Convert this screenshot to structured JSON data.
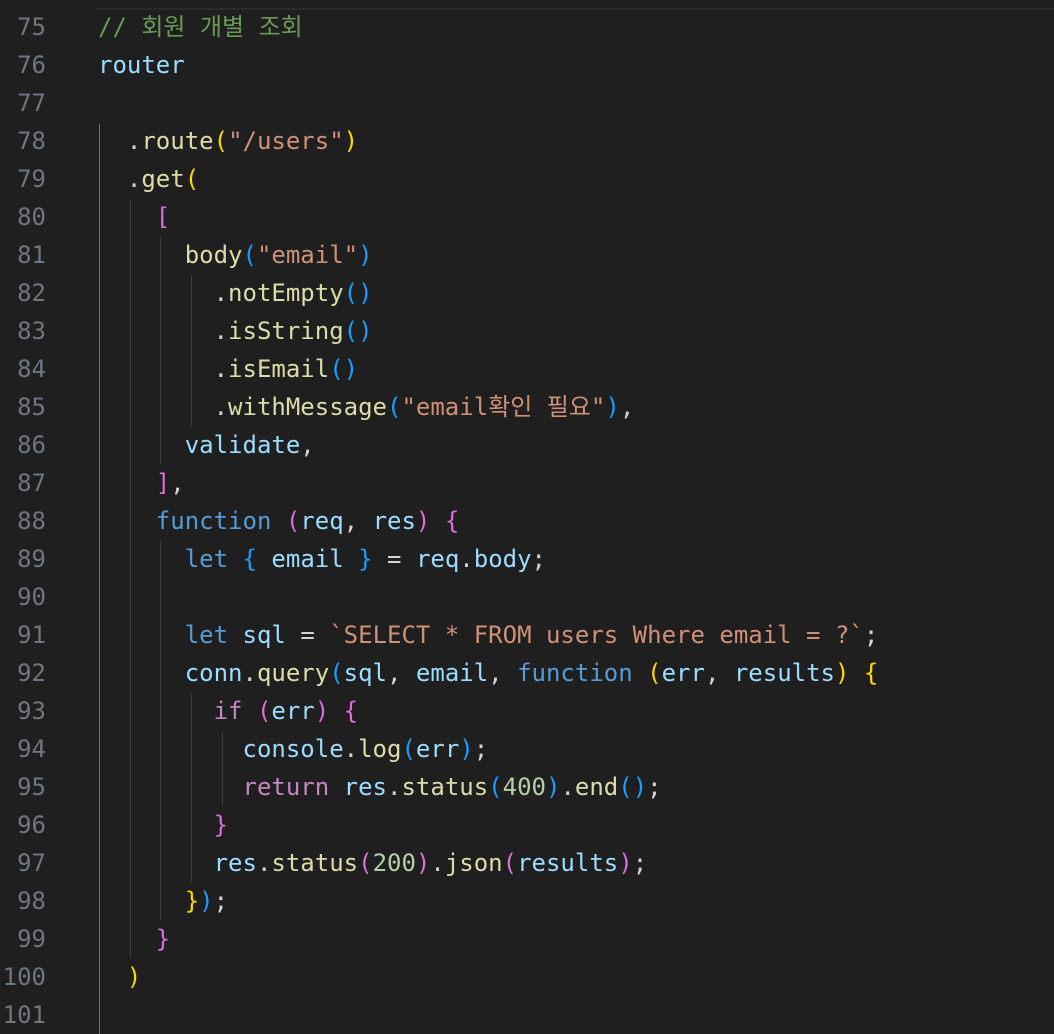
{
  "editor": {
    "colors": {
      "background": "#1f1f1f",
      "line_number": "#6e7681",
      "comment": "#6a9955",
      "variable": "#9cdcfe",
      "function": "#dcdcaa",
      "string": "#ce9178",
      "keyword": "#569cd6",
      "control": "#c586c0",
      "number": "#b5cea8",
      "bracket_level1": "#ffd700",
      "bracket_level2": "#da70d6",
      "bracket_level3": "#179fff"
    },
    "lines": [
      {
        "n": "75",
        "indent": 0,
        "tokens": [
          {
            "t": "// 회원 개별 조회",
            "c": "comment"
          }
        ]
      },
      {
        "n": "76",
        "indent": 0,
        "tokens": [
          {
            "t": "router",
            "c": "var"
          }
        ]
      },
      {
        "n": "77",
        "indent": 0,
        "tokens": []
      },
      {
        "n": "78",
        "indent": 2,
        "tokens": [
          {
            "t": ".",
            "c": "plain"
          },
          {
            "t": "route",
            "c": "fn"
          },
          {
            "t": "(",
            "c": "b1"
          },
          {
            "t": "\"/users\"",
            "c": "str"
          },
          {
            "t": ")",
            "c": "b1"
          }
        ]
      },
      {
        "n": "79",
        "indent": 2,
        "tokens": [
          {
            "t": ".",
            "c": "plain"
          },
          {
            "t": "get",
            "c": "fn"
          },
          {
            "t": "(",
            "c": "b1"
          }
        ]
      },
      {
        "n": "80",
        "indent": 4,
        "tokens": [
          {
            "t": "[",
            "c": "b2"
          }
        ]
      },
      {
        "n": "81",
        "indent": 6,
        "tokens": [
          {
            "t": "body",
            "c": "fn"
          },
          {
            "t": "(",
            "c": "b3"
          },
          {
            "t": "\"email\"",
            "c": "str"
          },
          {
            "t": ")",
            "c": "b3"
          }
        ]
      },
      {
        "n": "82",
        "indent": 8,
        "tokens": [
          {
            "t": ".",
            "c": "plain"
          },
          {
            "t": "notEmpty",
            "c": "fn"
          },
          {
            "t": "()",
            "c": "b3"
          }
        ]
      },
      {
        "n": "83",
        "indent": 8,
        "tokens": [
          {
            "t": ".",
            "c": "plain"
          },
          {
            "t": "isString",
            "c": "fn"
          },
          {
            "t": "()",
            "c": "b3"
          }
        ]
      },
      {
        "n": "84",
        "indent": 8,
        "tokens": [
          {
            "t": ".",
            "c": "plain"
          },
          {
            "t": "isEmail",
            "c": "fn"
          },
          {
            "t": "()",
            "c": "b3"
          }
        ]
      },
      {
        "n": "85",
        "indent": 8,
        "tokens": [
          {
            "t": ".",
            "c": "plain"
          },
          {
            "t": "withMessage",
            "c": "fn"
          },
          {
            "t": "(",
            "c": "b3"
          },
          {
            "t": "\"email확인 필요\"",
            "c": "str"
          },
          {
            "t": ")",
            "c": "b3"
          },
          {
            "t": ",",
            "c": "plain"
          }
        ]
      },
      {
        "n": "86",
        "indent": 6,
        "tokens": [
          {
            "t": "validate",
            "c": "var"
          },
          {
            "t": ",",
            "c": "plain"
          }
        ]
      },
      {
        "n": "87",
        "indent": 4,
        "tokens": [
          {
            "t": "]",
            "c": "b2"
          },
          {
            "t": ",",
            "c": "plain"
          }
        ]
      },
      {
        "n": "88",
        "indent": 4,
        "tokens": [
          {
            "t": "function",
            "c": "kw"
          },
          {
            "t": " ",
            "c": "plain"
          },
          {
            "t": "(",
            "c": "b2"
          },
          {
            "t": "req",
            "c": "var"
          },
          {
            "t": ", ",
            "c": "plain"
          },
          {
            "t": "res",
            "c": "var"
          },
          {
            "t": ")",
            "c": "b2"
          },
          {
            "t": " ",
            "c": "plain"
          },
          {
            "t": "{",
            "c": "b2"
          }
        ]
      },
      {
        "n": "89",
        "indent": 6,
        "tokens": [
          {
            "t": "let",
            "c": "kw"
          },
          {
            "t": " ",
            "c": "plain"
          },
          {
            "t": "{",
            "c": "b3"
          },
          {
            "t": " ",
            "c": "plain"
          },
          {
            "t": "email",
            "c": "var"
          },
          {
            "t": " ",
            "c": "plain"
          },
          {
            "t": "}",
            "c": "b3"
          },
          {
            "t": " = ",
            "c": "plain"
          },
          {
            "t": "req",
            "c": "var"
          },
          {
            "t": ".",
            "c": "plain"
          },
          {
            "t": "body",
            "c": "var"
          },
          {
            "t": ";",
            "c": "plain"
          }
        ]
      },
      {
        "n": "90",
        "indent": 0,
        "tokens": []
      },
      {
        "n": "91",
        "indent": 6,
        "tokens": [
          {
            "t": "let",
            "c": "kw"
          },
          {
            "t": " ",
            "c": "plain"
          },
          {
            "t": "sql",
            "c": "var"
          },
          {
            "t": " = ",
            "c": "plain"
          },
          {
            "t": "`SELECT * FROM users Where email = ?`",
            "c": "str"
          },
          {
            "t": ";",
            "c": "plain"
          }
        ]
      },
      {
        "n": "92",
        "indent": 6,
        "tokens": [
          {
            "t": "conn",
            "c": "var"
          },
          {
            "t": ".",
            "c": "plain"
          },
          {
            "t": "query",
            "c": "fn"
          },
          {
            "t": "(",
            "c": "b3"
          },
          {
            "t": "sql",
            "c": "var"
          },
          {
            "t": ", ",
            "c": "plain"
          },
          {
            "t": "email",
            "c": "var"
          },
          {
            "t": ", ",
            "c": "plain"
          },
          {
            "t": "function",
            "c": "kw"
          },
          {
            "t": " ",
            "c": "plain"
          },
          {
            "t": "(",
            "c": "b1"
          },
          {
            "t": "err",
            "c": "var"
          },
          {
            "t": ", ",
            "c": "plain"
          },
          {
            "t": "results",
            "c": "var"
          },
          {
            "t": ")",
            "c": "b1"
          },
          {
            "t": " ",
            "c": "plain"
          },
          {
            "t": "{",
            "c": "b1"
          }
        ]
      },
      {
        "n": "93",
        "indent": 8,
        "tokens": [
          {
            "t": "if",
            "c": "ctrl"
          },
          {
            "t": " ",
            "c": "plain"
          },
          {
            "t": "(",
            "c": "b2"
          },
          {
            "t": "err",
            "c": "var"
          },
          {
            "t": ")",
            "c": "b2"
          },
          {
            "t": " ",
            "c": "plain"
          },
          {
            "t": "{",
            "c": "b2"
          }
        ]
      },
      {
        "n": "94",
        "indent": 10,
        "tokens": [
          {
            "t": "console",
            "c": "var"
          },
          {
            "t": ".",
            "c": "plain"
          },
          {
            "t": "log",
            "c": "fn"
          },
          {
            "t": "(",
            "c": "b3"
          },
          {
            "t": "err",
            "c": "var"
          },
          {
            "t": ")",
            "c": "b3"
          },
          {
            "t": ";",
            "c": "plain"
          }
        ]
      },
      {
        "n": "95",
        "indent": 10,
        "tokens": [
          {
            "t": "return",
            "c": "ctrl"
          },
          {
            "t": " ",
            "c": "plain"
          },
          {
            "t": "res",
            "c": "var"
          },
          {
            "t": ".",
            "c": "plain"
          },
          {
            "t": "status",
            "c": "fn"
          },
          {
            "t": "(",
            "c": "b3"
          },
          {
            "t": "400",
            "c": "num"
          },
          {
            "t": ")",
            "c": "b3"
          },
          {
            "t": ".",
            "c": "plain"
          },
          {
            "t": "end",
            "c": "fn"
          },
          {
            "t": "()",
            "c": "b3"
          },
          {
            "t": ";",
            "c": "plain"
          }
        ]
      },
      {
        "n": "96",
        "indent": 8,
        "tokens": [
          {
            "t": "}",
            "c": "b2"
          }
        ]
      },
      {
        "n": "97",
        "indent": 8,
        "tokens": [
          {
            "t": "res",
            "c": "var"
          },
          {
            "t": ".",
            "c": "plain"
          },
          {
            "t": "status",
            "c": "fn"
          },
          {
            "t": "(",
            "c": "b2"
          },
          {
            "t": "200",
            "c": "num"
          },
          {
            "t": ")",
            "c": "b2"
          },
          {
            "t": ".",
            "c": "plain"
          },
          {
            "t": "json",
            "c": "fn"
          },
          {
            "t": "(",
            "c": "b2"
          },
          {
            "t": "results",
            "c": "var"
          },
          {
            "t": ")",
            "c": "b2"
          },
          {
            "t": ";",
            "c": "plain"
          }
        ]
      },
      {
        "n": "98",
        "indent": 6,
        "tokens": [
          {
            "t": "}",
            "c": "b1"
          },
          {
            "t": ")",
            "c": "b3"
          },
          {
            "t": ";",
            "c": "plain"
          }
        ]
      },
      {
        "n": "99",
        "indent": 4,
        "tokens": [
          {
            "t": "}",
            "c": "b2"
          }
        ]
      },
      {
        "n": "100",
        "indent": 2,
        "tokens": [
          {
            "t": ")",
            "c": "b1"
          }
        ]
      },
      {
        "n": "101",
        "indent": 0,
        "tokens": []
      }
    ]
  }
}
